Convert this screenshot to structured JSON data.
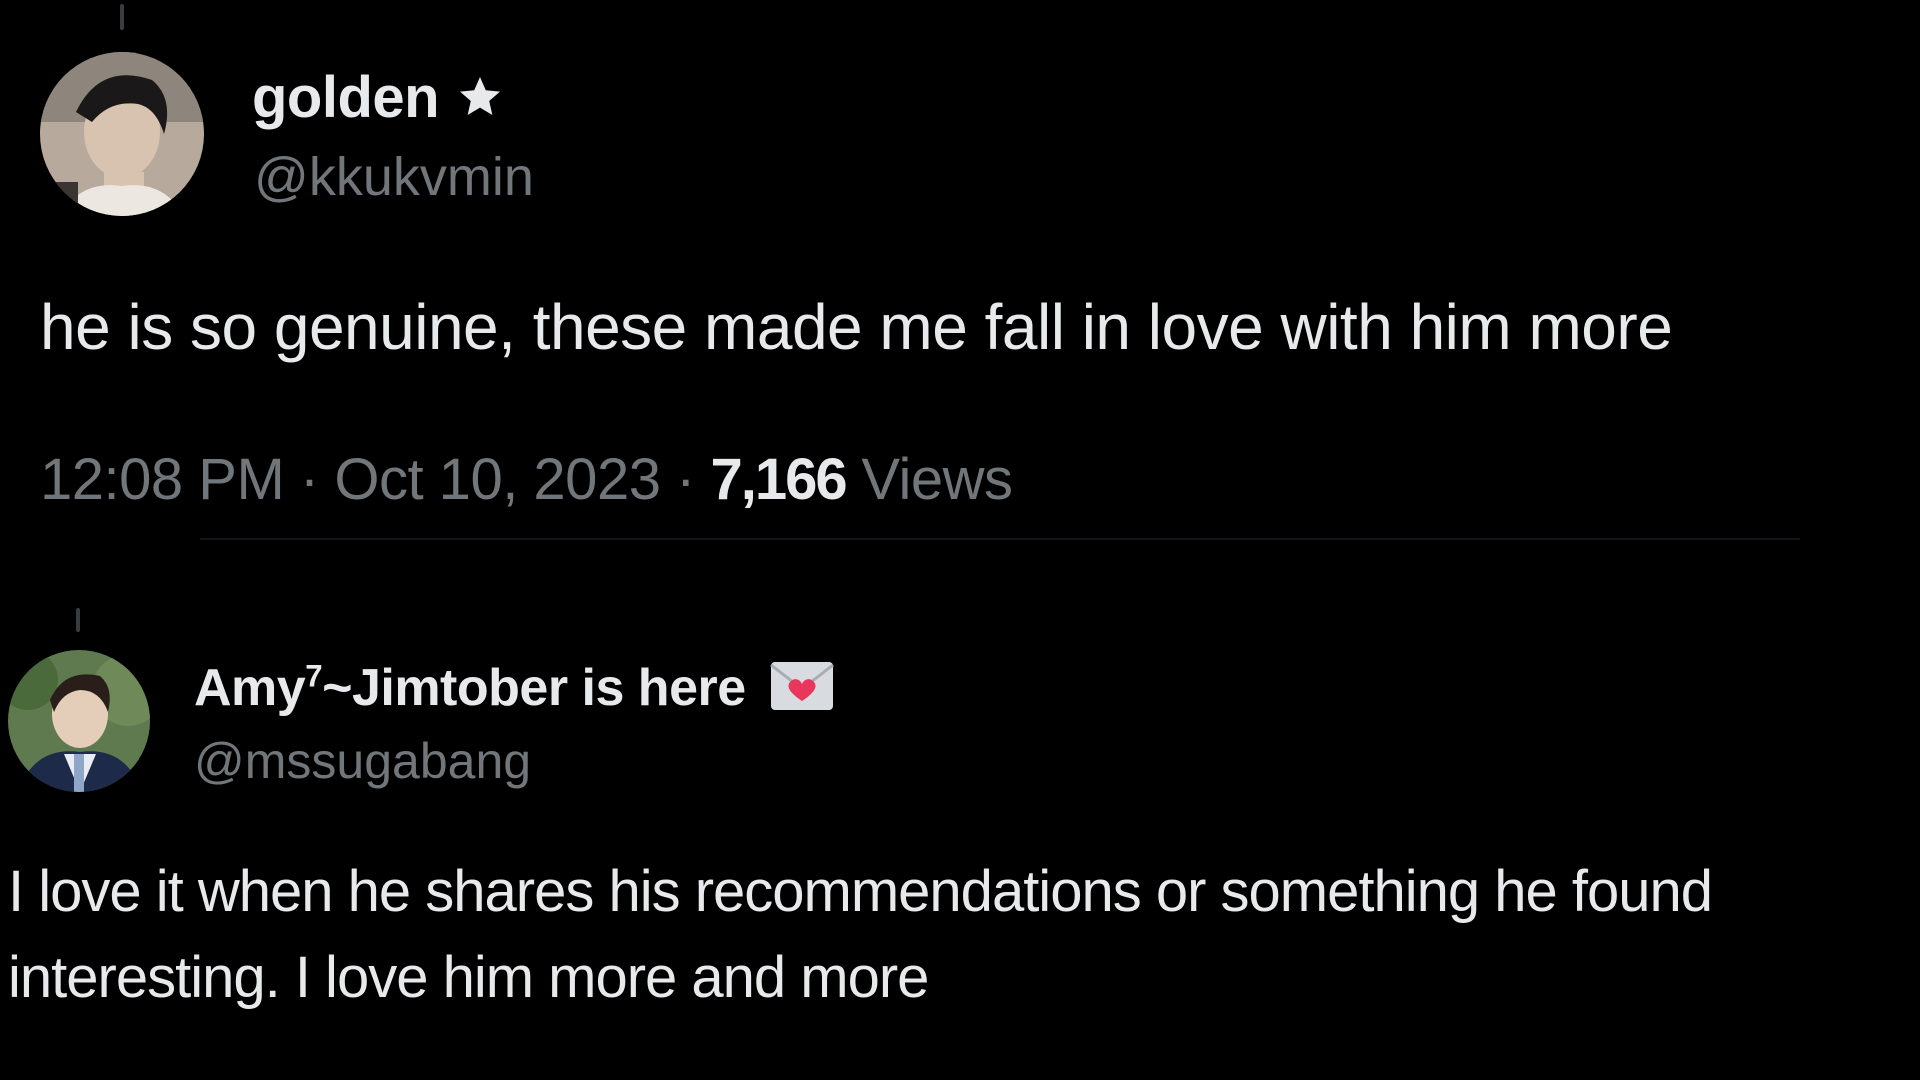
{
  "tweets": [
    {
      "display_name": "golden",
      "badge_icon": "star-icon",
      "handle": "@kkukvmin",
      "text": "he is so genuine, these made me fall in love with him more",
      "time": "12:08 PM",
      "separator": "·",
      "date": "Oct 10, 2023",
      "views_count": "7,166",
      "views_label": "Views"
    },
    {
      "display_name_main": "Amy",
      "display_name_sup": "7",
      "display_name_rest": "~Jimtober is here",
      "badge_icon": "love-letter-icon",
      "handle": "@mssugabang",
      "text_line1": "I love it when he shares his recommendations or something he found",
      "text_line2": "interesting. I love him more and more"
    }
  ],
  "colors": {
    "background": "#000000",
    "primary_text": "#e7e9ea",
    "secondary_text": "#71767b",
    "heart": "#e8365d"
  }
}
